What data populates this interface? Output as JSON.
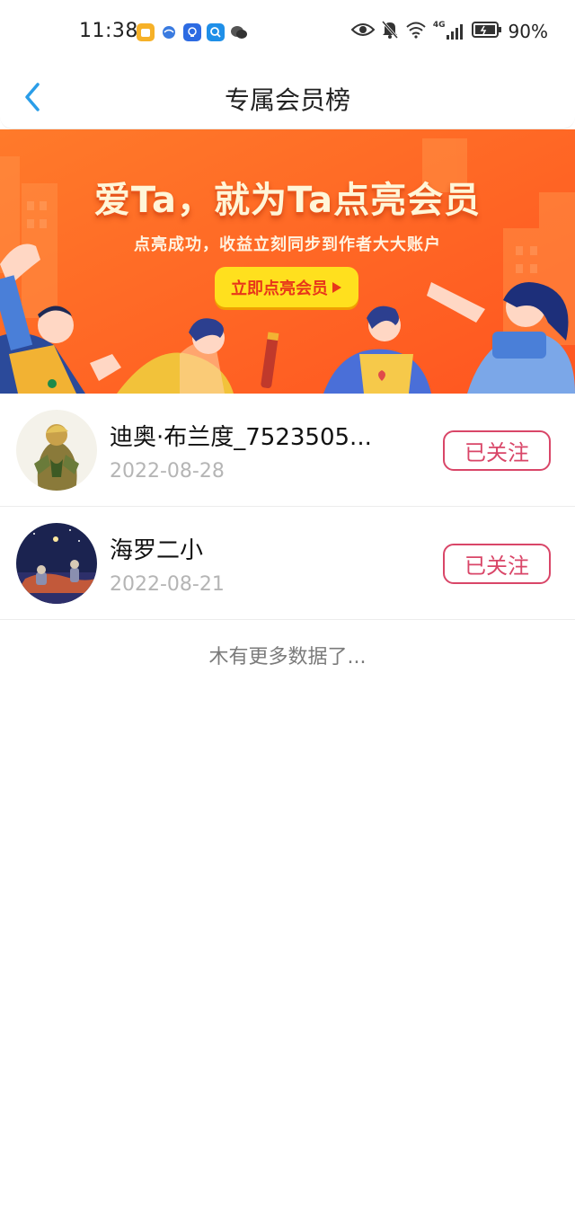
{
  "status_bar": {
    "time": "11:38",
    "app_icons": [
      "notes-app-icon",
      "browser-app-icon",
      "idea-app-icon",
      "search-app-icon",
      "wechat-app-icon"
    ],
    "network": "4G",
    "battery": "90%"
  },
  "header": {
    "title": "专属会员榜",
    "back_icon": "chevron-left-icon"
  },
  "banner": {
    "headline": "爱Ta，就为Ta点亮会员",
    "subtitle": "点亮成功，收益立刻同步到作者大大账户",
    "cta_label": "立即点亮会员",
    "colors": {
      "background": "#ff6a1e",
      "cta": "#ffe01e",
      "cta_text": "#e8361a"
    }
  },
  "members": [
    {
      "name": "迪奥·布兰度_7523505...",
      "date": "2022-08-28",
      "action": "已关注"
    },
    {
      "name": "海罗二小",
      "date": "2022-08-21",
      "action": "已关注"
    }
  ],
  "footer_note": "木有更多数据了...",
  "colors": {
    "accent": "#d94668",
    "back": "#2a9de8"
  }
}
